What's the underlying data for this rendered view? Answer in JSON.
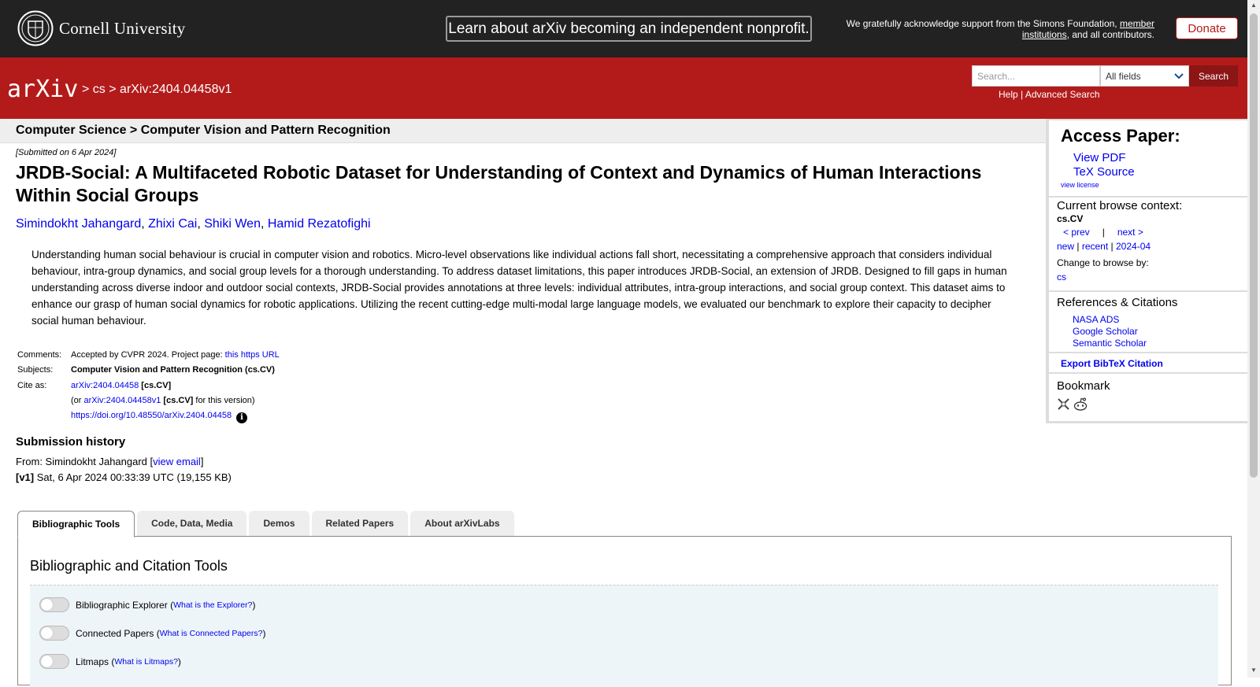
{
  "top": {
    "institution": "Cornell University",
    "announcement": "Learn about arXiv becoming an independent nonprofit.",
    "ack_prefix": "We gratefully acknowledge support from the Simons Foundation,",
    "ack_link": "member institutions",
    "ack_suffix": ", and all contributors.",
    "donate": "Donate"
  },
  "header": {
    "logo": "arXiv",
    "crumb_sep1": ">",
    "crumb_cs": "cs",
    "crumb_sep2": ">",
    "crumb_id": "arXiv:2404.04458v1",
    "search_placeholder": "Search...",
    "search_field": "All fields",
    "search_button": "Search",
    "help": "Help",
    "help_sep": "|",
    "advanced": "Advanced Search"
  },
  "subheader": "Computer Science > Computer Vision and Pattern Recognition",
  "paper": {
    "submitted": "[Submitted on 6 Apr 2024]",
    "title": "JRDB-Social: A Multifaceted Robotic Dataset for Understanding of Context and Dynamics of Human Interactions Within Social Groups",
    "authors": [
      "Simindokht Jahangard",
      "Zhixi Cai",
      "Shiki Wen",
      "Hamid Rezatofighi"
    ],
    "abstract": "Understanding human social behaviour is crucial in computer vision and robotics. Micro-level observations like individual actions fall short, necessitating a comprehensive approach that considers individual behaviour, intra-group dynamics, and social group levels for a thorough understanding. To address dataset limitations, this paper introduces JRDB-Social, an extension of JRDB. Designed to fill gaps in human understanding across diverse indoor and outdoor social contexts, JRDB-Social provides annotations at three levels: individual attributes, intra-group interactions, and social group context. This dataset aims to enhance our grasp of human social dynamics for robotic applications. Utilizing the recent cutting-edge multi-modal large language models, we evaluated our benchmark to explore their capacity to decipher social human behaviour."
  },
  "meta": {
    "comments_label": "Comments:",
    "comments_text": "Accepted by CVPR 2024. Project page: ",
    "comments_link": "this https URL",
    "subjects_label": "Subjects:",
    "subjects_text": "Computer Vision and Pattern Recognition (cs.CV)",
    "cite_label": "Cite as:",
    "cite_id": "arXiv:2404.04458",
    "cite_cat": "[cs.CV]",
    "cite_or": "(or ",
    "cite_version_id": "arXiv:2404.04458v1",
    "cite_version_cat": "[cs.CV]",
    "cite_version_suffix": " for this version)",
    "doi": "https://doi.org/10.48550/arXiv.2404.04458",
    "info_glyph": "i"
  },
  "history": {
    "title": "Submission history",
    "from_prefix": "From: Simindokht Jahangard [",
    "from_link": "view email",
    "from_suffix": "]",
    "v1_label": "[v1]",
    "v1_text": " Sat, 6 Apr 2024 00:33:39 UTC (19,155 KB)"
  },
  "tabs": [
    "Bibliographic Tools",
    "Code, Data, Media",
    "Demos",
    "Related Papers",
    "About arXivLabs"
  ],
  "panel": {
    "title": "Bibliographic and Citation Tools",
    "tools": [
      {
        "label": "Bibliographic Explorer",
        "link": "What is the Explorer?"
      },
      {
        "label": "Connected Papers",
        "link": "What is Connected Papers?"
      },
      {
        "label": "Litmaps",
        "link": "What is Litmaps?"
      }
    ]
  },
  "sidebar": {
    "access_title": "Access Paper:",
    "view_pdf": "View PDF",
    "tex_source": "TeX Source",
    "view_license": "view license",
    "context_title": "Current browse context:",
    "context_cat": "cs.CV",
    "prev": "< prev",
    "nav_sep": "|",
    "next": "next >",
    "new": "new",
    "recent": "recent",
    "month": "2024-04",
    "change_browse": "Change to browse by:",
    "browse_cs": "cs",
    "refs_title": "References & Citations",
    "nasa": "NASA ADS",
    "google": "Google Scholar",
    "semantic": "Semantic Scholar",
    "bibtex": "Export BibTeX Citation",
    "bookmark": "Bookmark"
  },
  "colors": {
    "arxiv_red": "#b31b1b",
    "link": "#0000ee",
    "topbar": "#222222"
  }
}
